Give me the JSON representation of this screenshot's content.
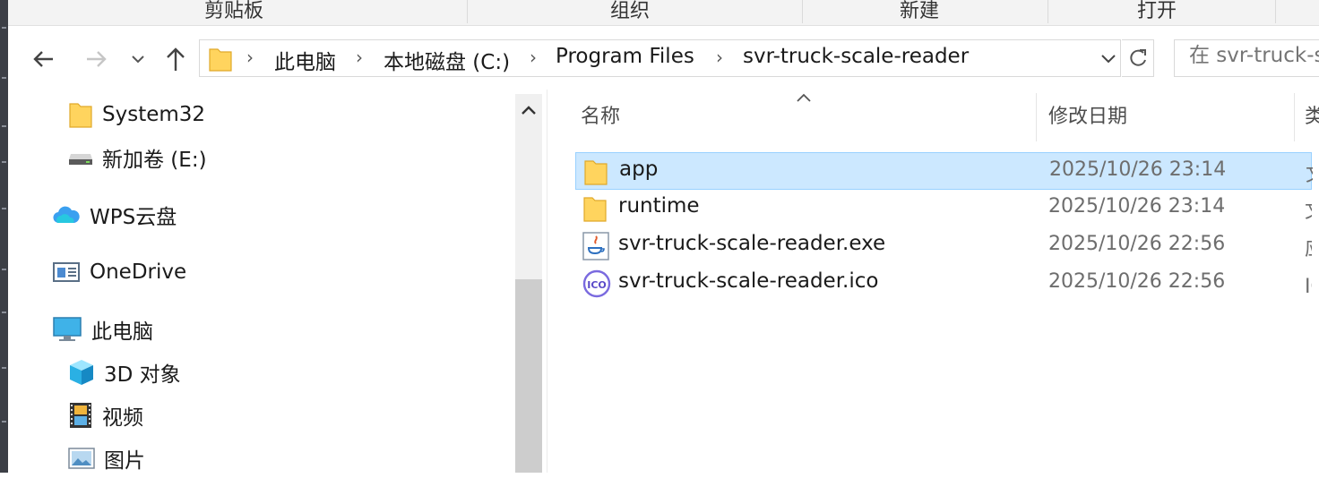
{
  "ribbon": {
    "groups": [
      "剪贴板",
      "组织",
      "新建",
      "打开"
    ]
  },
  "nav": {
    "back": "back-arrow",
    "forward": "forward-arrow",
    "recent": "chevron-down",
    "up": "up-arrow"
  },
  "address": {
    "crumbs": [
      "此电脑",
      "本地磁盘 (C:)",
      "Program Files",
      "svr-truck-scale-reader"
    ]
  },
  "search": {
    "placeholder": "在 svr-truck-scale-reader 中搜索"
  },
  "sidebar": {
    "items": [
      {
        "label": "System32",
        "icon": "folder-icon"
      },
      {
        "label": "新加卷 (E:)",
        "icon": "drive-icon"
      },
      {
        "label": "WPS云盘",
        "icon": "cloud-icon"
      },
      {
        "label": "OneDrive",
        "icon": "onedrive-icon"
      },
      {
        "label": "此电脑",
        "icon": "computer-icon"
      },
      {
        "label": "3D 对象",
        "icon": "cube-icon"
      },
      {
        "label": "视频",
        "icon": "video-icon"
      },
      {
        "label": "图片",
        "icon": "pictures-icon"
      }
    ]
  },
  "columns": {
    "name": "名称",
    "date": "修改日期",
    "type": "类型"
  },
  "files": [
    {
      "name": "app",
      "date": "2025/10/26 23:14",
      "type": "文件夹",
      "icon": "folder-icon",
      "selected": true
    },
    {
      "name": "runtime",
      "date": "2025/10/26 23:14",
      "type": "文件夹",
      "icon": "folder-icon",
      "selected": false
    },
    {
      "name": "svr-truck-scale-reader.exe",
      "date": "2025/10/26 22:56",
      "type": "应用程序",
      "icon": "java-exe-icon",
      "selected": false
    },
    {
      "name": "svr-truck-scale-reader.ico",
      "date": "2025/10/26 22:56",
      "type": "ICO 文件",
      "icon": "ico-file-icon",
      "selected": false
    }
  ],
  "colors": {
    "selection": "#cce8ff",
    "selection_border": "#99d1ff",
    "folder": "#ffd45e"
  }
}
